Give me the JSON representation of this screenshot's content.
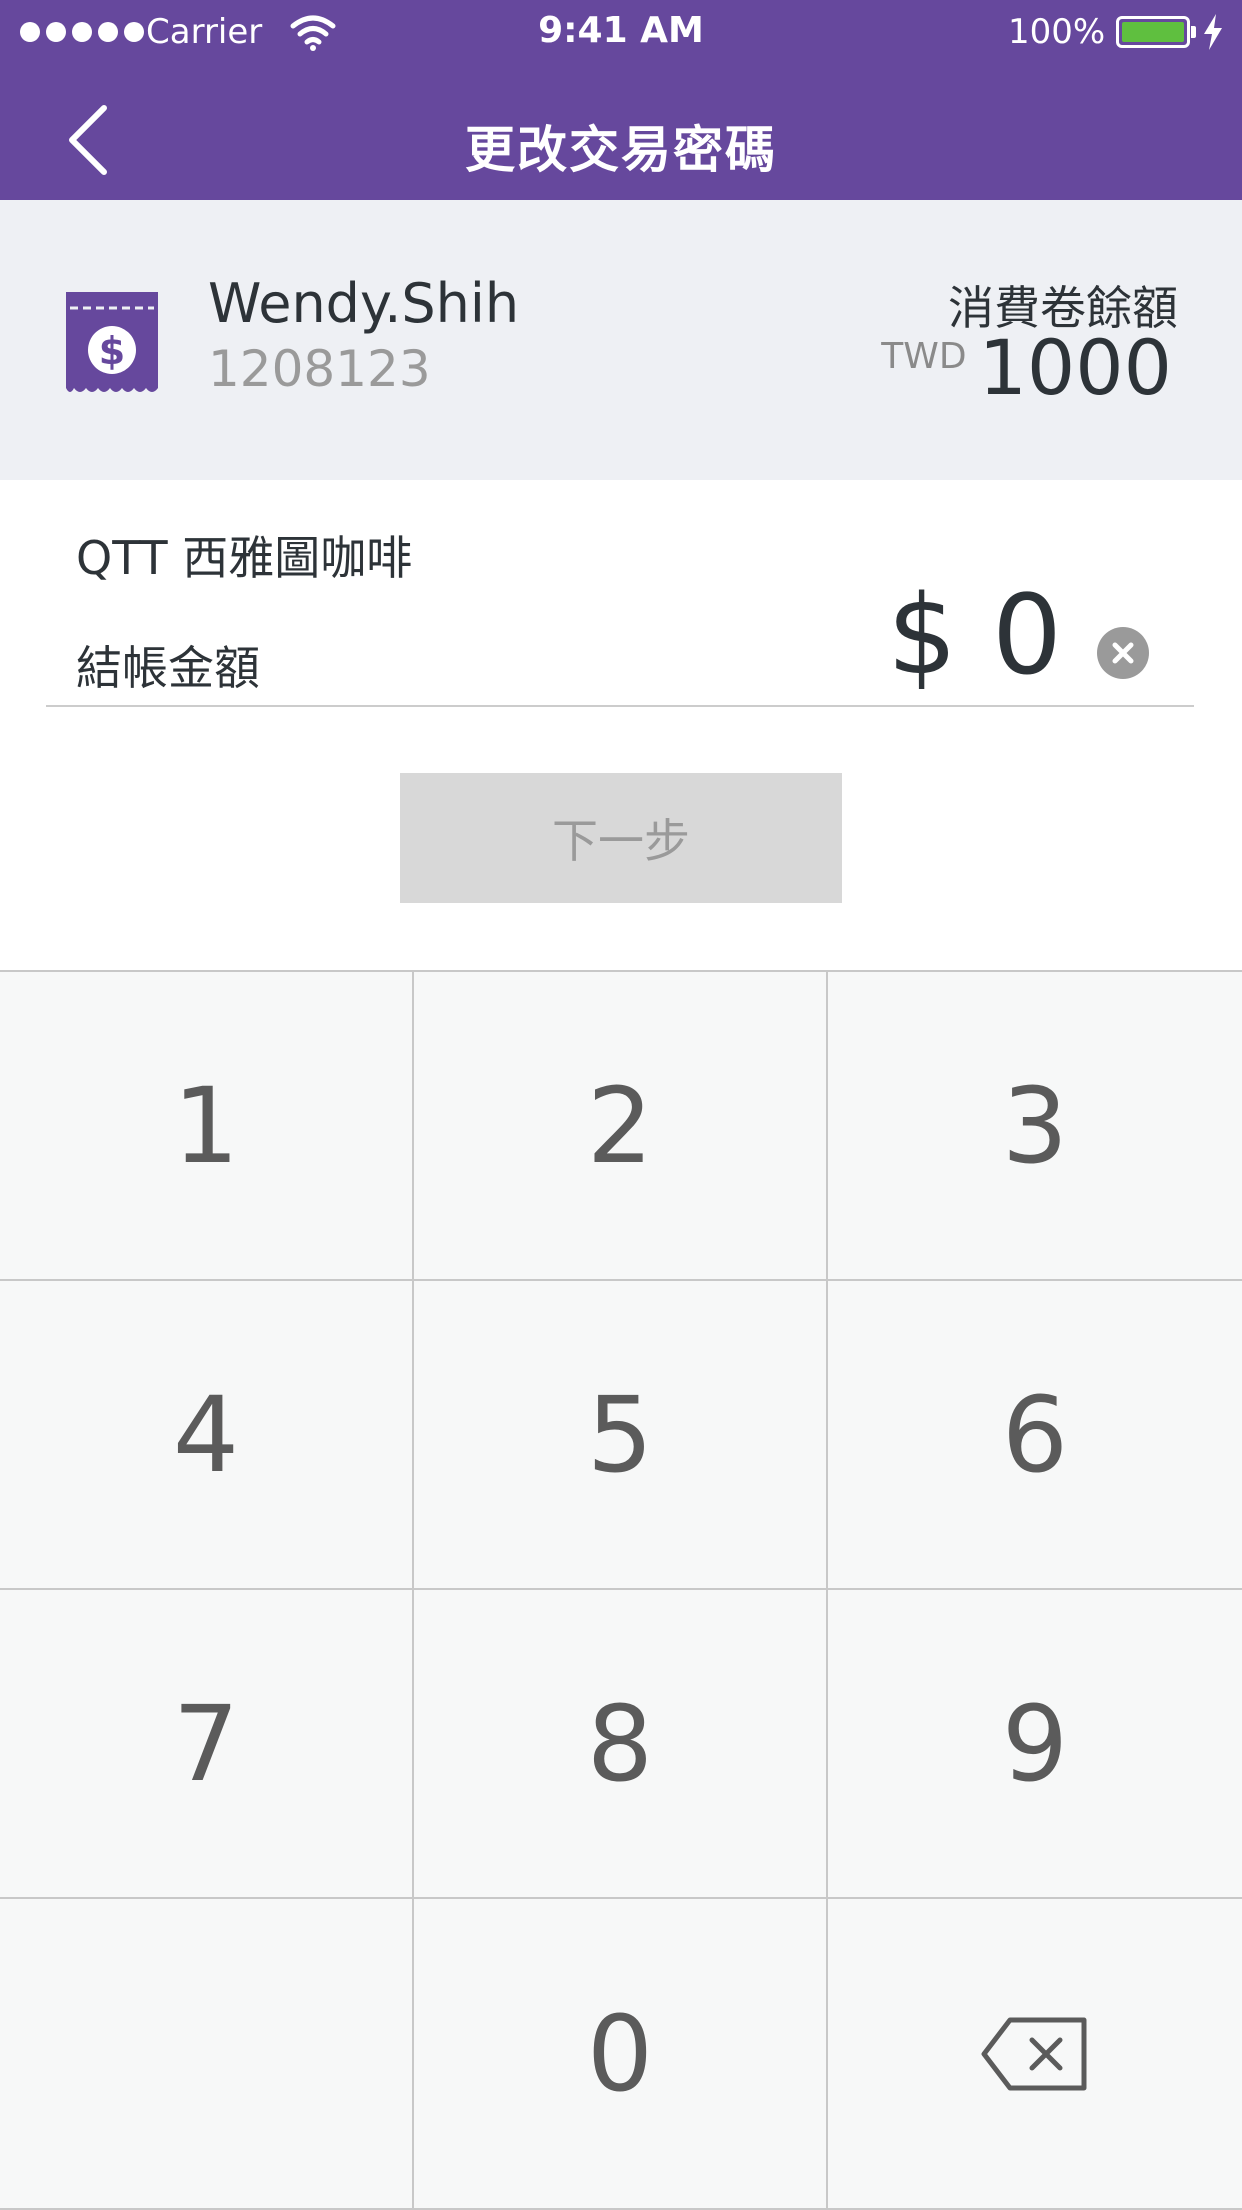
{
  "status_bar": {
    "carrier": "Carrier",
    "time": "9:41 AM",
    "battery": "100%"
  },
  "nav": {
    "title": "更改交易密碼",
    "back_icon": "chevron-left-icon"
  },
  "account": {
    "name": "Wendy.Shih",
    "id": "1208123",
    "balance_label": "消費卷餘額",
    "currency": "TWD",
    "balance": "1000",
    "icon": "coupon-dollar-icon"
  },
  "payment": {
    "merchant": "QTT 西雅圖咖啡",
    "amount_label": "結帳金額",
    "amount": "$ 0",
    "clear_icon": "clear-icon"
  },
  "next_button": {
    "label": "下一步"
  },
  "keypad": {
    "keys": [
      "1",
      "2",
      "3",
      "4",
      "5",
      "6",
      "7",
      "8",
      "9",
      "",
      "0",
      ""
    ],
    "backspace_icon": "backspace-icon"
  },
  "colors": {
    "brand": "#66489d",
    "panel": "#eef0f4",
    "key_bg": "#f7f8f8",
    "disabled": "#d8d8d8",
    "battery": "#5fbf3f"
  }
}
